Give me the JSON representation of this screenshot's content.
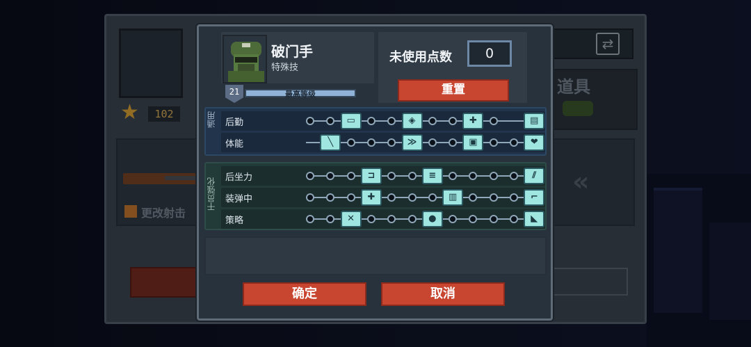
{
  "background": {
    "player_level": "102",
    "change_text": "更改射击",
    "items_label": "道具"
  },
  "character": {
    "name": "破门手",
    "subtitle": "特殊技",
    "level": "21",
    "level_progress": 1.0,
    "level_text": "最高等级"
  },
  "points": {
    "label": "未使用点数",
    "value": "0",
    "reset_label": "重置"
  },
  "skill_groups": [
    {
      "tag": "通用",
      "rows": [
        {
          "label": "后勤",
          "nodes": [
            0,
            1,
            3,
            4,
            6,
            7,
            9
          ],
          "icons": [
            {
              "slot": 2,
              "icon": "supply-icon",
              "glyph": "▭"
            },
            {
              "slot": 5,
              "icon": "shield-plus-icon",
              "glyph": "◈"
            },
            {
              "slot": 8,
              "icon": "medkit-icon",
              "glyph": "✚"
            },
            {
              "slot": 11,
              "icon": "ammo-crate-icon",
              "glyph": "▤"
            }
          ]
        },
        {
          "label": "体能",
          "nodes": [
            2,
            3,
            4,
            6,
            7,
            9,
            10
          ],
          "icons": [
            {
              "slot": 1,
              "icon": "knife-icon",
              "glyph": "╲"
            },
            {
              "slot": 5,
              "icon": "sprint-icon",
              "glyph": "≫"
            },
            {
              "slot": 8,
              "icon": "armor-icon",
              "glyph": "▣"
            },
            {
              "slot": 11,
              "icon": "heart-icon",
              "glyph": "❤"
            }
          ]
        }
      ]
    },
    {
      "tag": "干员强化",
      "rows": [
        {
          "label": "后坐力",
          "nodes": [
            0,
            1,
            2,
            4,
            5,
            7,
            8,
            9,
            10
          ],
          "icons": [
            {
              "slot": 3,
              "icon": "grip-icon",
              "glyph": "⊐"
            },
            {
              "slot": 6,
              "icon": "bullets-icon",
              "glyph": "≡"
            },
            {
              "slot": 11,
              "icon": "spread-icon",
              "glyph": "⫽"
            }
          ]
        },
        {
          "label": "装弹中",
          "nodes": [
            0,
            1,
            2,
            4,
            5,
            6,
            8,
            9,
            10
          ],
          "icons": [
            {
              "slot": 3,
              "icon": "reload-plus-icon",
              "glyph": "✚"
            },
            {
              "slot": 7,
              "icon": "magazine-icon",
              "glyph": "▥"
            },
            {
              "slot": 11,
              "icon": "gun-icon",
              "glyph": "⌐"
            }
          ]
        },
        {
          "label": "策略",
          "nodes": [
            0,
            1,
            3,
            4,
            5,
            7,
            8,
            9,
            10
          ],
          "icons": [
            {
              "slot": 2,
              "icon": "tools-icon",
              "glyph": "✕"
            },
            {
              "slot": 6,
              "icon": "grenade-icon",
              "glyph": "●"
            },
            {
              "slot": 11,
              "icon": "badge-icon",
              "glyph": "◣"
            }
          ]
        }
      ]
    }
  ],
  "buttons": {
    "confirm": "确定",
    "cancel": "取消"
  },
  "colors": {
    "accent_red": "#c84530",
    "skill_icon": "#9fe6e0",
    "general_group": "#21344b",
    "weapon_group": "#223a38"
  }
}
